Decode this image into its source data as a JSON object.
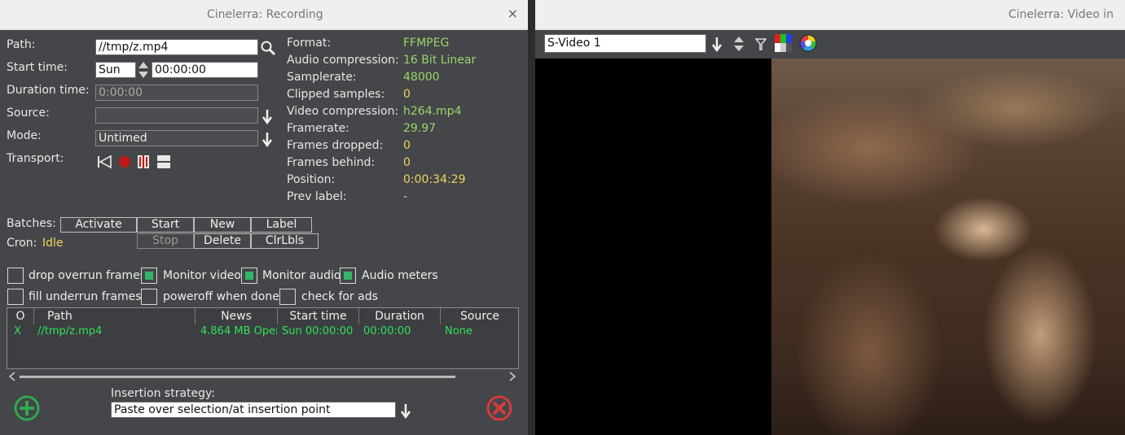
{
  "recording_window": {
    "title": "Cinelerra: Recording",
    "close_symbol": "×",
    "labels": {
      "path": "Path:",
      "start_time": "Start time:",
      "duration_time": "Duration time:",
      "source": "Source:",
      "mode": "Mode:",
      "transport": "Transport:"
    },
    "fields": {
      "path": "//tmp/z.mp4",
      "start_day": "Sun",
      "start_time": "00:00:00",
      "duration": "0:00:00",
      "source": "",
      "mode": "Untimed"
    },
    "info": [
      {
        "label": "Format:",
        "value": "FFMPEG",
        "color": "#9cd56a"
      },
      {
        "label": "Audio compression:",
        "value": "16 Bit Linear",
        "color": "#9cd56a"
      },
      {
        "label": "Samplerate:",
        "value": "48000",
        "color": "#9cd56a"
      },
      {
        "label": "Clipped samples:",
        "value": "0",
        "color": "#f2d35e"
      },
      {
        "label": "Video compression:",
        "value": "h264.mp4",
        "color": "#9cd56a"
      },
      {
        "label": "Framerate:",
        "value": "29.97",
        "color": "#9cd56a"
      },
      {
        "label": "Frames dropped:",
        "value": "0",
        "color": "#f2d35e"
      },
      {
        "label": "Frames behind:",
        "value": "0",
        "color": "#f2d35e"
      },
      {
        "label": "Position:",
        "value": "0:00:34:29",
        "color": "#f2d35e"
      },
      {
        "label": "Prev label:",
        "value": "-",
        "color": "#f2d35e"
      }
    ],
    "batches": {
      "label": "Batches:",
      "activate": "Activate",
      "start": "Start",
      "new": "New",
      "label_btn": "Label",
      "stop": "Stop",
      "delete": "Delete",
      "clrlbls": "ClrLbls"
    },
    "cron": {
      "label": "Cron:",
      "status": "Idle"
    },
    "options": [
      {
        "label": "drop overrun frames",
        "checked": false
      },
      {
        "label": "Monitor video",
        "checked": true
      },
      {
        "label": "Monitor audio",
        "checked": true
      },
      {
        "label": "Audio meters",
        "checked": true
      },
      {
        "label": "fill underrun frames",
        "checked": false
      },
      {
        "label": "poweroff when done",
        "checked": false
      },
      {
        "label": "check for ads",
        "checked": false
      }
    ],
    "list": {
      "columns": [
        "O",
        "Path",
        "News",
        "Start time",
        "Duration",
        "Source"
      ],
      "rows": [
        {
          "on": "X",
          "path": "//tmp/z.mp4",
          "news": "4.864 MB Oper",
          "start": "Sun 00:00:00",
          "duration": "00:00:00",
          "source": "None"
        }
      ]
    },
    "insertion": {
      "label": "Insertion strategy:",
      "value": "Paste over selection/at insertion point"
    }
  },
  "video_window": {
    "title": "Cinelerra: Video in",
    "channel": "S-Video 1"
  },
  "colors": {
    "panel": "#444649",
    "value_green": "#9cd56a",
    "value_yellow": "#f2d35e",
    "list_green": "#2fe05a",
    "checkbox_on": "#33b56a",
    "record_red": "#c01818"
  }
}
